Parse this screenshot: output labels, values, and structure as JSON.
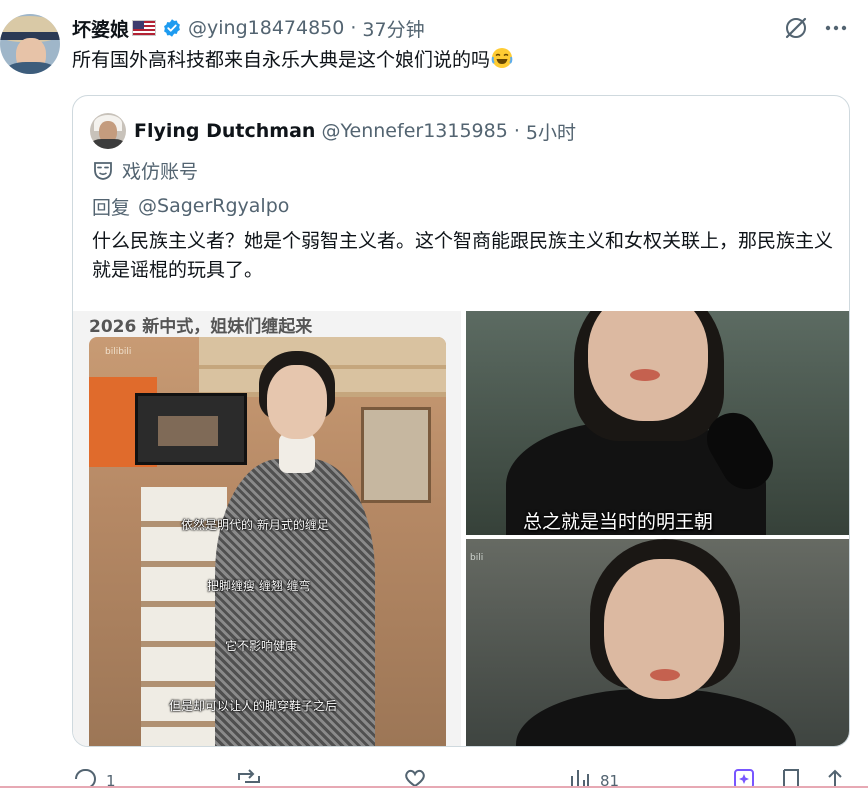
{
  "post": {
    "display_name": "坏婆娘",
    "flag_icon": "us-flag-icon",
    "verified_icon": "verified-badge-icon",
    "handle": "@ying18474850",
    "separator": "·",
    "time": "37分钟",
    "text": "所有国外高科技都来自永乐大典是这个娘们说的吗",
    "emoji": "face-with-tears-of-joy-icon"
  },
  "header_actions": {
    "grok_icon": "grok-icon",
    "more_icon": "more-icon"
  },
  "quoted": {
    "display_name": "Flying Dutchman",
    "handle": "@Yennefer1315985",
    "separator": "·",
    "time": "5小时",
    "parody_label": "戏仿账号",
    "reply_prefix": "回复",
    "reply_mention": "@SagerRgyalpo",
    "text": "什么民族主义者？她是个弱智主义者。这个智商能跟民族主义和女权关联上，那民族主义就是谣棍的玩具了。",
    "media": {
      "left_heading": "2026 新中式，姐妹们缠起来",
      "left_watermark": "bilibili",
      "subtitles": [
        "依然是明代的 新月式的缠足",
        "把脚缠瘦 缠翘 缠弯",
        "它不影响健康",
        "但是却可以让人的脚穿鞋子之后"
      ],
      "right_top_caption": "总之就是当时的明王朝",
      "right_bottom_watermark": "bili"
    }
  },
  "actions": {
    "reply_count": "1",
    "repost_count": "",
    "like_count": "",
    "views_count": "81",
    "icons": [
      "reply-icon",
      "repost-icon",
      "like-icon",
      "views-icon",
      "grok-analyze-icon",
      "bookmark-icon",
      "share-icon"
    ]
  },
  "colors": {
    "text": "#0f1419",
    "secondary": "#536471",
    "verified": "#1d9bf0",
    "border": "#cfd9de",
    "accent": "#7856ff"
  }
}
